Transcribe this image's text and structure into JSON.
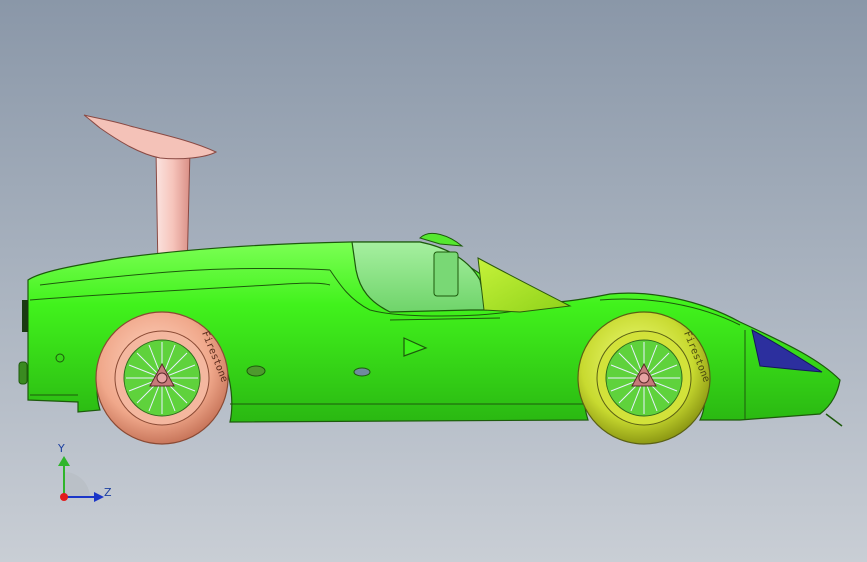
{
  "viewport": {
    "background_top": "#8a97a8",
    "background_bottom": "#c9ced5"
  },
  "model": {
    "body_color": "#3ef21a",
    "body_outline": "#1d5a0c",
    "canopy_color": "#8de38a",
    "intake_color": "#f3b8b0",
    "headlight_color": "#2c2f9e",
    "rear_wheel_color": "#eda58a",
    "front_wheel_color": "#c6d92e",
    "hub_color": "#c77a7a",
    "tire_brand_text": "Firestone"
  },
  "triad": {
    "y_label": "Y",
    "z_label": "Z",
    "y_axis_color": "#2fb52a",
    "z_axis_color": "#1b36c8",
    "x_axis_color": "#e21c1c"
  }
}
